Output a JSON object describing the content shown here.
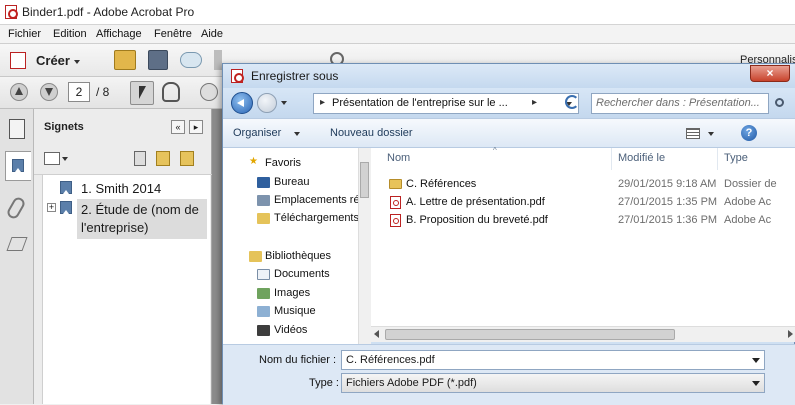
{
  "window": {
    "title": "Binder1.pdf - Adobe Acrobat Pro"
  },
  "menu": [
    "Fichier",
    "Edition",
    "Affichage",
    "Fenêtre",
    "Aide"
  ],
  "toolbar": {
    "create_label": "Créer",
    "personalize_label": "Personnalis"
  },
  "pagenav": {
    "current_page": "2",
    "total_pages": "/ 8"
  },
  "bookmarks_panel": {
    "title": "Signets",
    "items": [
      {
        "label": "1. Smith 2014"
      },
      {
        "label_line1": "2. Étude de (nom de",
        "label_line2": "l'entreprise)"
      }
    ]
  },
  "dialog": {
    "title": "Enregistrer sous",
    "close_glyph": "×",
    "address": {
      "path": "Présentation de l'entreprise sur le ...",
      "separator": "▸"
    },
    "search": {
      "placeholder": "Rechercher dans : Présentation..."
    },
    "commands": {
      "organize": "Organiser",
      "new_folder": "Nouveau dossier",
      "help": "?"
    },
    "nav": {
      "favorites": "Favoris",
      "favorites_items": [
        "Bureau",
        "Emplacements ré",
        "Téléchargements"
      ],
      "libraries": "Bibliothèques",
      "libraries_items": [
        "Documents",
        "Images",
        "Musique",
        "Vidéos"
      ]
    },
    "columns": {
      "name": "Nom",
      "modified": "Modifié le",
      "type": "Type"
    },
    "files": [
      {
        "name": "C. Références",
        "modified": "29/01/2015 9:18 AM",
        "type": "Dossier de",
        "kind": "folder"
      },
      {
        "name": "A. Lettre de présentation.pdf",
        "modified": "27/01/2015 1:35 PM",
        "type": "Adobe Ac",
        "kind": "pdf"
      },
      {
        "name": "B. Proposition du breveté.pdf",
        "modified": "27/01/2015 1:36 PM",
        "type": "Adobe Ac",
        "kind": "pdf"
      }
    ],
    "filename": {
      "label": "Nom du fichier :",
      "value": "C. Références.pdf"
    },
    "filetype": {
      "label": "Type :",
      "value": "Fichiers Adobe PDF (*.pdf)"
    }
  },
  "colors": {
    "dialog_frame": "#cfe0f2",
    "close_red": "#c8432c",
    "selection": "#dcdcdc"
  }
}
